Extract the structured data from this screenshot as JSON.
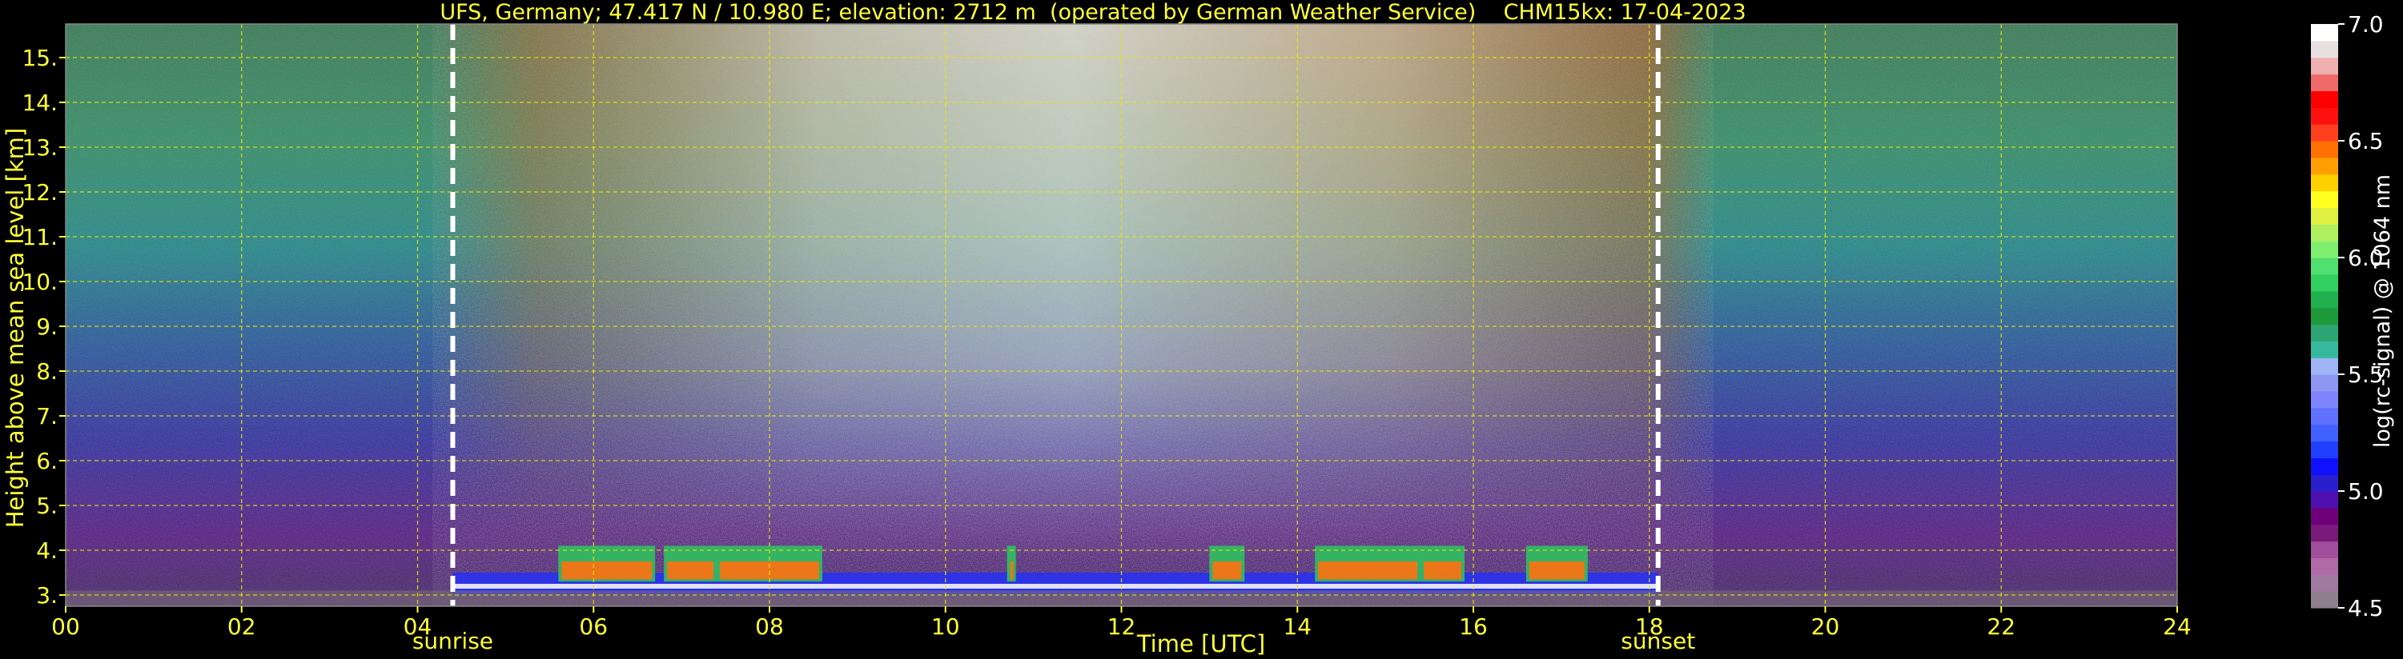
{
  "chart_data": {
    "type": "heatmap",
    "title": "UFS, Germany; 47.417 N / 10.980 E; elevation: 2712 m  (operated by German Weather Service)    CHM15kx: 17-04-2023",
    "xlabel": "Time [UTC]",
    "ylabel": "Height above mean sea level [km]",
    "xlim": [
      0,
      24
    ],
    "ylim": [
      2.75,
      15.75
    ],
    "x_ticks": [
      0,
      2,
      4,
      6,
      8,
      10,
      12,
      14,
      16,
      18,
      20,
      22,
      24
    ],
    "x_tick_labels": [
      "00",
      "02",
      "04",
      "06",
      "08",
      "10",
      "12",
      "14",
      "16",
      "18",
      "20",
      "22",
      "24"
    ],
    "y_ticks": [
      3,
      4,
      5,
      6,
      7,
      8,
      9,
      10,
      11,
      12,
      13,
      14,
      15
    ],
    "y_tick_labels": [
      "3.",
      "4.",
      "5.",
      "6.",
      "7.",
      "8.",
      "9.",
      "10.",
      "11.",
      "12.",
      "13.",
      "14.",
      "15."
    ],
    "grid": true,
    "event_markers": [
      {
        "label": "sunrise",
        "time": 4.4
      },
      {
        "label": "sunset",
        "time": 18.1
      }
    ],
    "colorbar": {
      "label": "log(rc-signal) @ 1064 nm",
      "min": 4.5,
      "max": 7.0,
      "ticks": [
        4.5,
        5.0,
        5.5,
        6.0,
        6.5,
        7.0
      ],
      "tick_labels": [
        "4.5",
        "5.0",
        "5.5",
        "6.0",
        "6.5",
        "7.0"
      ],
      "colors": [
        "#8e7f8e",
        "#a07aa0",
        "#b06aa6",
        "#a14f9c",
        "#7a1a7a",
        "#70007a",
        "#5010b0",
        "#2a1fcc",
        "#1010ff",
        "#2040ff",
        "#4060ff",
        "#6070ff",
        "#7f85ff",
        "#8e97f2",
        "#9fb4f5",
        "#35b89b",
        "#2ca573",
        "#1f9a3a",
        "#20b050",
        "#30cf60",
        "#50e070",
        "#80ef70",
        "#b0f060",
        "#e0f040",
        "#ffff20",
        "#ffd000",
        "#ffa000",
        "#ff7000",
        "#ff4020",
        "#ff1010",
        "#ff0000",
        "#f06a6a",
        "#f0b0b0",
        "#e8e0e0",
        "#ffffff"
      ]
    }
  }
}
